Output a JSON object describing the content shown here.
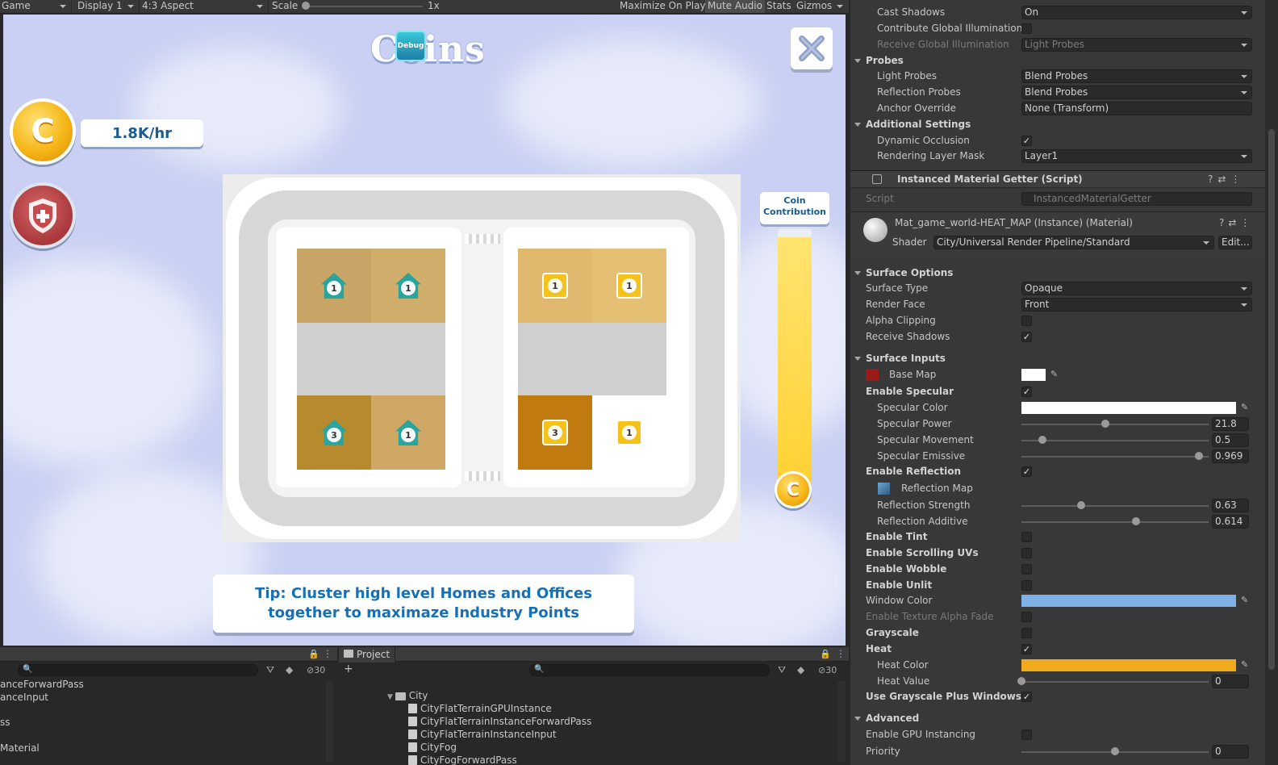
{
  "toolbar": {
    "game_tab": "Game",
    "display": "Display 1",
    "aspect": "4:3 Aspect",
    "scale_label": "Scale",
    "scale_value": "1x",
    "maximize": "Maximize On Play",
    "mute": "Mute Audio",
    "stats": "Stats",
    "gizmos": "Gizmos"
  },
  "game": {
    "title": "Coins",
    "debug_badge": "Debug",
    "coin_symbol": "C",
    "rate": "1.8K/hr",
    "contribution_label": "Coin Contribution",
    "contribution_level": 0.97,
    "tip": "Tip: Cluster high level Homes and Offices together to maximaze Industry Points",
    "lots": [
      {
        "kind": "home",
        "level": "1"
      },
      {
        "kind": "home",
        "level": "1"
      },
      {
        "kind": "shop",
        "level": "1"
      },
      {
        "kind": "shop",
        "level": "1"
      },
      {
        "kind": "home",
        "level": "3"
      },
      {
        "kind": "home",
        "level": "1"
      },
      {
        "kind": "shop",
        "level": "3"
      },
      {
        "kind": "shop",
        "level": "1"
      }
    ]
  },
  "hierarchy_panel": {
    "count": "30",
    "rows": [
      "anceForwardPass",
      "anceInput",
      "ss",
      "Material"
    ]
  },
  "project_panel": {
    "tab": "Project",
    "count": "30",
    "rows": [
      "City",
      "CityFlatTerrainGPUInstance",
      "CityFlatTerrainInstanceForwardPass",
      "CityFlatTerrainInstanceInput",
      "CityFog",
      "CityFogForwardPass"
    ]
  },
  "inspector": {
    "cast_shadows": {
      "label": "Cast Shadows",
      "value": "On"
    },
    "contribute_gi": {
      "label": "Contribute Global Illumination"
    },
    "receive_gi": {
      "label": "Receive Global Illumination",
      "value": "Light Probes"
    },
    "probes": "Probes",
    "light_probes": {
      "label": "Light Probes",
      "value": "Blend Probes"
    },
    "reflection_probes": {
      "label": "Reflection Probes",
      "value": "Blend Probes"
    },
    "anchor_override": {
      "label": "Anchor Override",
      "value": "None (Transform)"
    },
    "additional_settings": "Additional Settings",
    "dynamic_occlusion": {
      "label": "Dynamic Occlusion"
    },
    "rendering_layer_mask": {
      "label": "Rendering Layer Mask",
      "value": "Layer1"
    },
    "component_title": "Instanced Material Getter (Script)",
    "script": {
      "label": "Script",
      "value": "InstancedMaterialGetter"
    },
    "material_name": "Mat_game_world-HEAT_MAP (Instance) (Material)",
    "shader": {
      "label": "Shader",
      "value": "City/Universal Render Pipeline/Standard",
      "edit": "Edit..."
    },
    "surface_options": "Surface Options",
    "surface_type": {
      "label": "Surface Type",
      "value": "Opaque"
    },
    "render_face": {
      "label": "Render Face",
      "value": "Front"
    },
    "alpha_clipping": {
      "label": "Alpha Clipping"
    },
    "receive_shadows": {
      "label": "Receive Shadows"
    },
    "surface_inputs": "Surface Inputs",
    "base_map": {
      "label": "Base Map"
    },
    "enable_specular": {
      "label": "Enable Specular"
    },
    "specular_color": {
      "label": "Specular Color"
    },
    "specular_power": {
      "label": "Specular Power",
      "value": "21.8",
      "level": 0.45
    },
    "specular_movement": {
      "label": "Specular Movement",
      "value": "0.5",
      "level": 0.11
    },
    "specular_emissive": {
      "label": "Specular Emissive",
      "value": "0.969",
      "level": 0.95
    },
    "enable_reflection": {
      "label": "Enable Reflection"
    },
    "reflection_map": {
      "label": "Reflection Map"
    },
    "reflection_strength": {
      "label": "Reflection Strength",
      "value": "0.63",
      "level": 0.32
    },
    "reflection_additive": {
      "label": "Reflection Additive",
      "value": "0.614",
      "level": 0.61
    },
    "enable_tint": {
      "label": "Enable Tint"
    },
    "enable_scrolling_uvs": {
      "label": "Enable Scrolling UVs"
    },
    "enable_wobble": {
      "label": "Enable Wobble"
    },
    "enable_unlit": {
      "label": "Enable Unlit"
    },
    "window_color": {
      "label": "Window Color",
      "color": "#7fb0e6"
    },
    "enable_texture_alpha_fade": {
      "label": "Enable Texture Alpha Fade"
    },
    "grayscale": {
      "label": "Grayscale"
    },
    "heat": {
      "label": "Heat"
    },
    "heat_color": {
      "label": "Heat Color",
      "color": "#f0aa1e"
    },
    "heat_value": {
      "label": "Heat Value",
      "value": "0",
      "level": 0
    },
    "use_grayscale_plus_windows": {
      "label": "Use Grayscale Plus Windows"
    },
    "advanced": "Advanced",
    "enable_gpu_instancing": {
      "label": "Enable GPU Instancing"
    },
    "priority": {
      "label": "Priority",
      "value": "0",
      "level": 0.5
    }
  }
}
